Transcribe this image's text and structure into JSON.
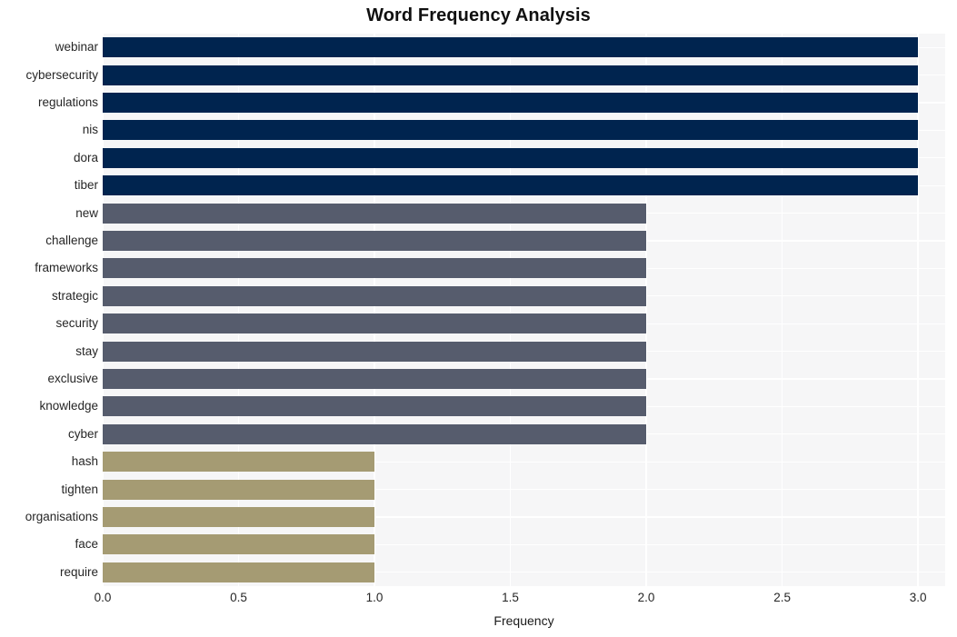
{
  "chart_data": {
    "type": "bar",
    "orientation": "horizontal",
    "title": "Word Frequency Analysis",
    "xlabel": "Frequency",
    "ylabel": "",
    "xlim": [
      0.0,
      3.1
    ],
    "xticks": [
      "0.0",
      "0.5",
      "1.0",
      "1.5",
      "2.0",
      "2.5",
      "3.0"
    ],
    "xtick_values": [
      0.0,
      0.5,
      1.0,
      1.5,
      2.0,
      2.5,
      3.0
    ],
    "grid": true,
    "legend": "none",
    "categories": [
      "webinar",
      "cybersecurity",
      "regulations",
      "nis",
      "dora",
      "tiber",
      "new",
      "challenge",
      "frameworks",
      "strategic",
      "security",
      "stay",
      "exclusive",
      "knowledge",
      "cyber",
      "hash",
      "tighten",
      "organisations",
      "face",
      "require"
    ],
    "values": [
      3,
      3,
      3,
      3,
      3,
      3,
      2,
      2,
      2,
      2,
      2,
      2,
      2,
      2,
      2,
      1,
      1,
      1,
      1,
      1
    ],
    "bar_colors": [
      "#00244f",
      "#00244f",
      "#00244f",
      "#00244f",
      "#00244f",
      "#00244f",
      "#565c6d",
      "#565c6d",
      "#565c6d",
      "#565c6d",
      "#565c6d",
      "#565c6d",
      "#565c6d",
      "#565c6d",
      "#565c6d",
      "#a59b73",
      "#a59b73",
      "#a59b73",
      "#a59b73",
      "#a59b73"
    ]
  },
  "style": {
    "plot_background": "#f6f6f7",
    "grid_color": "#ffffff",
    "figure_background": "#ffffff",
    "tick_color": "#262626",
    "title_color": "#101010"
  }
}
